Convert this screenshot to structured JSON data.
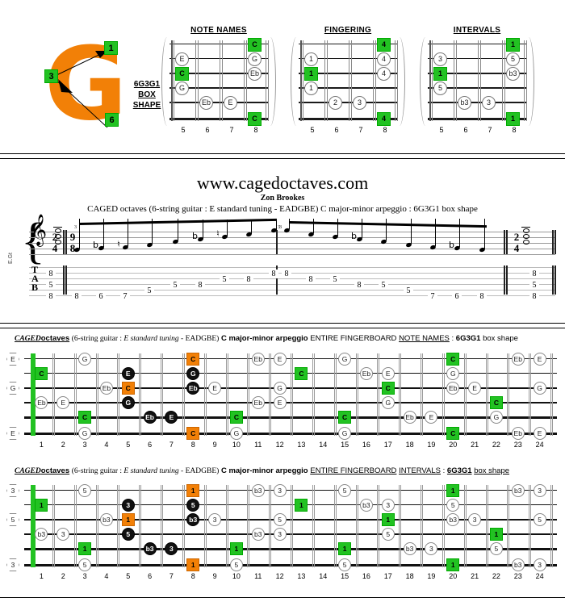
{
  "logo": {
    "letter": "G",
    "badges": [
      {
        "label": "1"
      },
      {
        "label": "3"
      },
      {
        "label": "6"
      }
    ],
    "name": "6G3G1",
    "line2": "BOX",
    "line3": "SHAPE"
  },
  "box_diagrams": [
    {
      "title": "NOTE NAMES",
      "frets": [
        "5",
        "6",
        "7",
        "8"
      ],
      "markers": [
        {
          "string": 1,
          "fret": 8,
          "label": "C",
          "style": "sq"
        },
        {
          "string": 2,
          "fret": 5,
          "label": "E",
          "style": "circ"
        },
        {
          "string": 2,
          "fret": 8,
          "label": "G",
          "style": "circ"
        },
        {
          "string": 3,
          "fret": 5,
          "label": "C",
          "style": "sq"
        },
        {
          "string": 3,
          "fret": 8,
          "label": "Eb",
          "style": "circ"
        },
        {
          "string": 4,
          "fret": 5,
          "label": "G",
          "style": "circ"
        },
        {
          "string": 5,
          "fret": 6,
          "label": "Eb",
          "style": "circ"
        },
        {
          "string": 5,
          "fret": 7,
          "label": "E",
          "style": "circ"
        },
        {
          "string": 6,
          "fret": 8,
          "label": "C",
          "style": "sq"
        }
      ]
    },
    {
      "title": "FINGERING",
      "frets": [
        "5",
        "6",
        "7",
        "8"
      ],
      "markers": [
        {
          "string": 1,
          "fret": 8,
          "label": "4",
          "style": "sq"
        },
        {
          "string": 2,
          "fret": 5,
          "label": "1",
          "style": "circ"
        },
        {
          "string": 2,
          "fret": 8,
          "label": "4",
          "style": "circ"
        },
        {
          "string": 3,
          "fret": 5,
          "label": "1",
          "style": "sq"
        },
        {
          "string": 3,
          "fret": 8,
          "label": "4",
          "style": "circ"
        },
        {
          "string": 4,
          "fret": 5,
          "label": "1",
          "style": "circ"
        },
        {
          "string": 5,
          "fret": 6,
          "label": "2",
          "style": "circ"
        },
        {
          "string": 5,
          "fret": 7,
          "label": "3",
          "style": "circ"
        },
        {
          "string": 6,
          "fret": 8,
          "label": "4",
          "style": "sq"
        }
      ]
    },
    {
      "title": "INTERVALS",
      "frets": [
        "5",
        "6",
        "7",
        "8"
      ],
      "markers": [
        {
          "string": 1,
          "fret": 8,
          "label": "1",
          "style": "sq"
        },
        {
          "string": 2,
          "fret": 5,
          "label": "3",
          "style": "circ"
        },
        {
          "string": 2,
          "fret": 8,
          "label": "5",
          "style": "circ"
        },
        {
          "string": 3,
          "fret": 5,
          "label": "1",
          "style": "sq"
        },
        {
          "string": 3,
          "fret": 8,
          "label": "b3",
          "style": "circ"
        },
        {
          "string": 4,
          "fret": 5,
          "label": "5",
          "style": "circ"
        },
        {
          "string": 5,
          "fret": 6,
          "label": "b3",
          "style": "circ"
        },
        {
          "string": 5,
          "fret": 7,
          "label": "3",
          "style": "circ"
        },
        {
          "string": 6,
          "fret": 8,
          "label": "1",
          "style": "sq"
        }
      ]
    }
  ],
  "site": {
    "title": "www.cagedoctaves.com",
    "author": "Zon Brookes",
    "subtitle": "CAGED octaves (6-string guitar : E standard tuning - EADGBE) C major-minor arpeggio : 6G3G1 box shape"
  },
  "notation": {
    "instrument_label": "E.Gt",
    "clef": "𝄞",
    "time_signature_start": {
      "top": "2",
      "bottom": "4"
    },
    "time_signature_main": {
      "top": "9",
      "bottom": "8"
    },
    "time_signature_end": {
      "top": "2",
      "bottom": "4"
    },
    "tab_letters": [
      "T",
      "A",
      "B"
    ],
    "chord_start": [
      "8",
      "5",
      "8"
    ],
    "chord_end": [
      "8",
      "5",
      "8"
    ],
    "tuplet_marks": [
      "3",
      "3",
      "3"
    ],
    "ascending_tab": [
      {
        "string": 6,
        "fret": "8"
      },
      {
        "string": 6,
        "fret": "6"
      },
      {
        "string": 6,
        "fret": "7"
      },
      {
        "string": 5,
        "fret": "5"
      },
      {
        "string": 4,
        "fret": "5"
      },
      {
        "string": 4,
        "fret": "8"
      },
      {
        "string": 3,
        "fret": "5"
      },
      {
        "string": 3,
        "fret": "8"
      },
      {
        "string": 2,
        "fret": "8"
      }
    ],
    "descending_tab": [
      {
        "string": 2,
        "fret": "8"
      },
      {
        "string": 3,
        "fret": "8"
      },
      {
        "string": 3,
        "fret": "5"
      },
      {
        "string": 4,
        "fret": "8"
      },
      {
        "string": 4,
        "fret": "5"
      },
      {
        "string": 5,
        "fret": "5"
      },
      {
        "string": 6,
        "fret": "7"
      },
      {
        "string": 6,
        "fret": "6"
      },
      {
        "string": 6,
        "fret": "8"
      }
    ]
  },
  "fretboards": [
    {
      "header": {
        "caged": "CAGED",
        "octaves": "octaves",
        "spec_open": "(6-string guitar : ",
        "tuning_italic": "E standard tuning",
        "spec_dash": " - ",
        "tuning": "EADGBE)",
        "arpeggio": "C major-minor arpeggio",
        "scope": "ENTIRE FINGERBOARD",
        "mode": "NOTE NAMES",
        "colon": " : ",
        "shape": "6G3G1",
        "shape_suffix": "box shape"
      },
      "fret_numbers": [
        "1",
        "2",
        "3",
        "4",
        "5",
        "6",
        "7",
        "8",
        "9",
        "10",
        "11",
        "12",
        "13",
        "14",
        "15",
        "16",
        "17",
        "18",
        "19",
        "20",
        "21",
        "22",
        "23",
        "24"
      ],
      "open_strings": [
        {
          "string": 1,
          "label": "E"
        },
        {
          "string": 3,
          "label": "G"
        },
        {
          "string": 6,
          "label": "E"
        }
      ],
      "notes": [
        {
          "string": 2,
          "fret": 1,
          "label": "C",
          "style": "g"
        },
        {
          "string": 4,
          "fret": 1,
          "label": "Eb",
          "style": "w"
        },
        {
          "string": 4,
          "fret": 2,
          "label": "E",
          "style": "w"
        },
        {
          "string": 1,
          "fret": 3,
          "label": "G",
          "style": "w"
        },
        {
          "string": 5,
          "fret": 3,
          "label": "C",
          "style": "g"
        },
        {
          "string": 6,
          "fret": 3,
          "label": "G",
          "style": "w"
        },
        {
          "string": 3,
          "fret": 4,
          "label": "Eb",
          "style": "w"
        },
        {
          "string": 2,
          "fret": 5,
          "label": "E",
          "style": "k"
        },
        {
          "string": 3,
          "fret": 5,
          "label": "C",
          "style": "o"
        },
        {
          "string": 4,
          "fret": 5,
          "label": "G",
          "style": "k"
        },
        {
          "string": 5,
          "fret": 6,
          "label": "Eb",
          "style": "k"
        },
        {
          "string": 5,
          "fret": 7,
          "label": "E",
          "style": "k"
        },
        {
          "string": 1,
          "fret": 8,
          "label": "C",
          "style": "o"
        },
        {
          "string": 2,
          "fret": 8,
          "label": "G",
          "style": "k"
        },
        {
          "string": 3,
          "fret": 8,
          "label": "Eb",
          "style": "k"
        },
        {
          "string": 6,
          "fret": 8,
          "label": "C",
          "style": "o"
        },
        {
          "string": 3,
          "fret": 9,
          "label": "E",
          "style": "w"
        },
        {
          "string": 5,
          "fret": 10,
          "label": "C",
          "style": "g"
        },
        {
          "string": 6,
          "fret": 10,
          "label": "G",
          "style": "w"
        },
        {
          "string": 1,
          "fret": 11,
          "label": "Eb",
          "style": "w"
        },
        {
          "string": 4,
          "fret": 11,
          "label": "Eb",
          "style": "w"
        },
        {
          "string": 1,
          "fret": 12,
          "label": "E",
          "style": "w"
        },
        {
          "string": 3,
          "fret": 12,
          "label": "G",
          "style": "w"
        },
        {
          "string": 4,
          "fret": 12,
          "label": "E",
          "style": "w"
        },
        {
          "string": 2,
          "fret": 13,
          "label": "C",
          "style": "g"
        },
        {
          "string": 1,
          "fret": 15,
          "label": "G",
          "style": "w"
        },
        {
          "string": 5,
          "fret": 15,
          "label": "C",
          "style": "g"
        },
        {
          "string": 6,
          "fret": 15,
          "label": "G",
          "style": "w"
        },
        {
          "string": 2,
          "fret": 16,
          "label": "Eb",
          "style": "w"
        },
        {
          "string": 2,
          "fret": 17,
          "label": "E",
          "style": "w"
        },
        {
          "string": 3,
          "fret": 17,
          "label": "C",
          "style": "g"
        },
        {
          "string": 4,
          "fret": 17,
          "label": "G",
          "style": "w"
        },
        {
          "string": 5,
          "fret": 18,
          "label": "Eb",
          "style": "w"
        },
        {
          "string": 5,
          "fret": 19,
          "label": "E",
          "style": "w"
        },
        {
          "string": 1,
          "fret": 20,
          "label": "C",
          "style": "g"
        },
        {
          "string": 2,
          "fret": 20,
          "label": "G",
          "style": "w"
        },
        {
          "string": 3,
          "fret": 20,
          "label": "Eb",
          "style": "w"
        },
        {
          "string": 6,
          "fret": 20,
          "label": "C",
          "style": "g"
        },
        {
          "string": 3,
          "fret": 21,
          "label": "E",
          "style": "w"
        },
        {
          "string": 4,
          "fret": 22,
          "label": "C",
          "style": "g"
        },
        {
          "string": 5,
          "fret": 22,
          "label": "G",
          "style": "w"
        },
        {
          "string": 1,
          "fret": 23,
          "label": "Eb",
          "style": "w"
        },
        {
          "string": 6,
          "fret": 23,
          "label": "Eb",
          "style": "w"
        },
        {
          "string": 1,
          "fret": 24,
          "label": "E",
          "style": "w"
        },
        {
          "string": 3,
          "fret": 24,
          "label": "G",
          "style": "w"
        },
        {
          "string": 6,
          "fret": 24,
          "label": "E",
          "style": "w"
        }
      ]
    },
    {
      "header": {
        "caged": "CAGED",
        "octaves": "octaves",
        "spec_open": "(6-string guitar : ",
        "tuning_italic": "E standard tuning",
        "spec_dash": " - ",
        "tuning": "EADGBE)",
        "arpeggio": "C major-minor arpeggio",
        "scope": "ENTIRE FINGERBOARD",
        "mode": "INTERVALS",
        "colon": " : ",
        "shape": "6G3G1",
        "shape_suffix": "box shape"
      },
      "fret_numbers": [
        "1",
        "2",
        "3",
        "4",
        "5",
        "6",
        "7",
        "8",
        "9",
        "10",
        "11",
        "12",
        "13",
        "14",
        "15",
        "16",
        "17",
        "18",
        "19",
        "20",
        "21",
        "22",
        "23",
        "24"
      ],
      "open_strings": [
        {
          "string": 1,
          "label": "3"
        },
        {
          "string": 3,
          "label": "5"
        },
        {
          "string": 6,
          "label": "3"
        }
      ],
      "notes": [
        {
          "string": 2,
          "fret": 1,
          "label": "1",
          "style": "g"
        },
        {
          "string": 4,
          "fret": 1,
          "label": "b3",
          "style": "w"
        },
        {
          "string": 4,
          "fret": 2,
          "label": "3",
          "style": "w"
        },
        {
          "string": 1,
          "fret": 3,
          "label": "5",
          "style": "w"
        },
        {
          "string": 5,
          "fret": 3,
          "label": "1",
          "style": "g"
        },
        {
          "string": 6,
          "fret": 3,
          "label": "5",
          "style": "w"
        },
        {
          "string": 3,
          "fret": 4,
          "label": "b3",
          "style": "w"
        },
        {
          "string": 2,
          "fret": 5,
          "label": "3",
          "style": "k"
        },
        {
          "string": 3,
          "fret": 5,
          "label": "1",
          "style": "o"
        },
        {
          "string": 4,
          "fret": 5,
          "label": "5",
          "style": "k"
        },
        {
          "string": 5,
          "fret": 6,
          "label": "b3",
          "style": "k"
        },
        {
          "string": 5,
          "fret": 7,
          "label": "3",
          "style": "k"
        },
        {
          "string": 1,
          "fret": 8,
          "label": "1",
          "style": "o"
        },
        {
          "string": 2,
          "fret": 8,
          "label": "5",
          "style": "k"
        },
        {
          "string": 3,
          "fret": 8,
          "label": "b3",
          "style": "k"
        },
        {
          "string": 6,
          "fret": 8,
          "label": "1",
          "style": "o"
        },
        {
          "string": 3,
          "fret": 9,
          "label": "3",
          "style": "w"
        },
        {
          "string": 5,
          "fret": 10,
          "label": "1",
          "style": "g"
        },
        {
          "string": 6,
          "fret": 10,
          "label": "5",
          "style": "w"
        },
        {
          "string": 1,
          "fret": 11,
          "label": "b3",
          "style": "w"
        },
        {
          "string": 4,
          "fret": 11,
          "label": "b3",
          "style": "w"
        },
        {
          "string": 1,
          "fret": 12,
          "label": "3",
          "style": "w"
        },
        {
          "string": 3,
          "fret": 12,
          "label": "5",
          "style": "w"
        },
        {
          "string": 4,
          "fret": 12,
          "label": "3",
          "style": "w"
        },
        {
          "string": 2,
          "fret": 13,
          "label": "1",
          "style": "g"
        },
        {
          "string": 1,
          "fret": 15,
          "label": "5",
          "style": "w"
        },
        {
          "string": 5,
          "fret": 15,
          "label": "1",
          "style": "g"
        },
        {
          "string": 6,
          "fret": 15,
          "label": "5",
          "style": "w"
        },
        {
          "string": 2,
          "fret": 16,
          "label": "b3",
          "style": "w"
        },
        {
          "string": 2,
          "fret": 17,
          "label": "3",
          "style": "w"
        },
        {
          "string": 3,
          "fret": 17,
          "label": "1",
          "style": "g"
        },
        {
          "string": 4,
          "fret": 17,
          "label": "5",
          "style": "w"
        },
        {
          "string": 5,
          "fret": 18,
          "label": "b3",
          "style": "w"
        },
        {
          "string": 5,
          "fret": 19,
          "label": "3",
          "style": "w"
        },
        {
          "string": 1,
          "fret": 20,
          "label": "1",
          "style": "g"
        },
        {
          "string": 2,
          "fret": 20,
          "label": "5",
          "style": "w"
        },
        {
          "string": 3,
          "fret": 20,
          "label": "b3",
          "style": "w"
        },
        {
          "string": 6,
          "fret": 20,
          "label": "1",
          "style": "g"
        },
        {
          "string": 3,
          "fret": 21,
          "label": "3",
          "style": "w"
        },
        {
          "string": 4,
          "fret": 22,
          "label": "1",
          "style": "g"
        },
        {
          "string": 5,
          "fret": 22,
          "label": "5",
          "style": "w"
        },
        {
          "string": 1,
          "fret": 23,
          "label": "b3",
          "style": "w"
        },
        {
          "string": 6,
          "fret": 23,
          "label": "b3",
          "style": "w"
        },
        {
          "string": 1,
          "fret": 24,
          "label": "3",
          "style": "w"
        },
        {
          "string": 3,
          "fret": 24,
          "label": "5",
          "style": "w"
        },
        {
          "string": 6,
          "fret": 24,
          "label": "3",
          "style": "w"
        }
      ]
    }
  ],
  "colors": {
    "green": "#22C222",
    "orange": "#F28007",
    "black": "#111111",
    "white": "#FFFFFF"
  }
}
